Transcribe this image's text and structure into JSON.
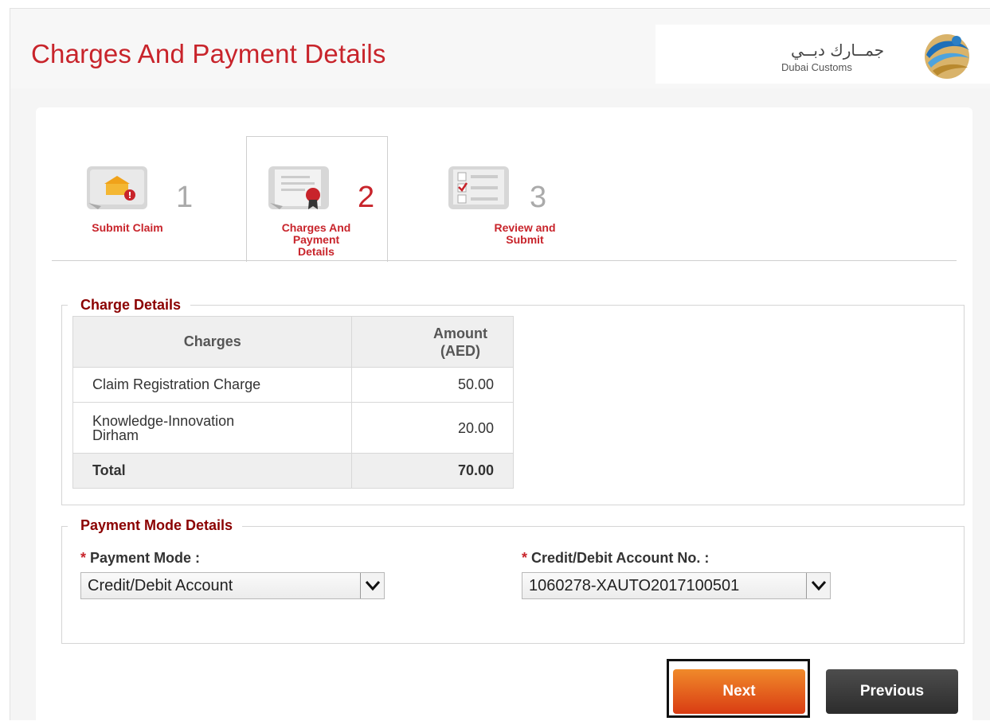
{
  "header": {
    "title": "Charges And Payment Details",
    "logo_arabic": "جمــارك دبــي",
    "logo_english": "Dubai Customs"
  },
  "steps": [
    {
      "number": "1",
      "label": "Submit Claim",
      "icon": "submit-claim-icon",
      "active": false
    },
    {
      "number": "2",
      "label": "Charges And Payment Details",
      "icon": "certificate-icon",
      "active": true
    },
    {
      "number": "3",
      "label": "Review and Submit",
      "icon": "checklist-icon",
      "active": false
    }
  ],
  "charge_details": {
    "legend": "Charge Details",
    "headers": {
      "charges": "Charges",
      "amount": "Amount (AED)"
    },
    "rows": [
      {
        "name": "Claim Registration Charge",
        "amount": "50.00"
      },
      {
        "name": "Knowledge-Innovation Dirham",
        "amount": "20.00"
      }
    ],
    "total": {
      "name": "Total",
      "amount": "70.00"
    }
  },
  "payment_mode_details": {
    "legend": "Payment Mode Details",
    "payment_mode": {
      "required_mark": "*",
      "label": "Payment Mode :",
      "value": "Credit/Debit Account"
    },
    "account_no": {
      "required_mark": "*",
      "label": "Credit/Debit Account No. :",
      "value": "1060278-XAUTO2017100501"
    }
  },
  "buttons": {
    "next": "Next",
    "previous": "Previous"
  },
  "colors": {
    "brand_red": "#c8242b",
    "legend_red": "#8b0000",
    "next_orange": "#e0561b",
    "previous_dark": "#3a3a3a"
  }
}
